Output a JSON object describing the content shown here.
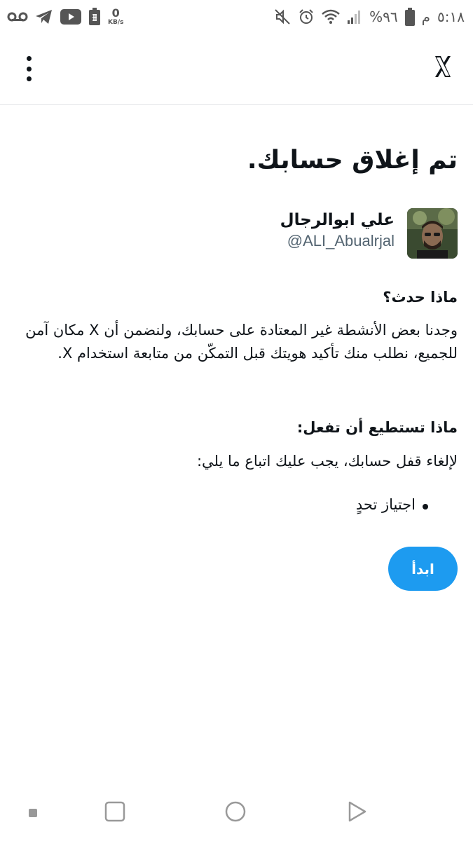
{
  "status_bar": {
    "left_icons": [
      "voicemail-icon",
      "telegram-icon",
      "youtube-icon",
      "sim-battery-icon"
    ],
    "net_speed_value": "0",
    "net_speed_unit": "KB/s",
    "battery_percent": "%٩٦",
    "clock_ampm": "م",
    "clock_time": "٥:١٨"
  },
  "app_bar": {
    "logo": "X",
    "menu_icon": "more-vertical-icon"
  },
  "page": {
    "title": "تم إغلاق حسابك.",
    "profile": {
      "name": "علي ابوالرجال",
      "handle": "@ALI_Abualrjal"
    },
    "what_happened_heading": "ماذا حدث؟",
    "what_happened_body": "وجدنا بعض الأنشطة غير المعتادة على حسابك، ولنضمن أن X مكان آمن للجميع، نطلب منك تأكيد هويتك قبل التمكّن من متابعة استخدام X.",
    "what_to_do_heading": "ماذا تستطيع أن تفعل:",
    "what_to_do_body": "لإلغاء قفل حسابك، يجب عليك اتباع ما يلي:",
    "steps": [
      "اجتياز تحدٍ"
    ],
    "start_button": "ابدأ"
  },
  "colors": {
    "accent": "#1d9bf0",
    "text": "#0f1419",
    "secondary_text": "#536471",
    "divider": "#e4e6e8"
  }
}
